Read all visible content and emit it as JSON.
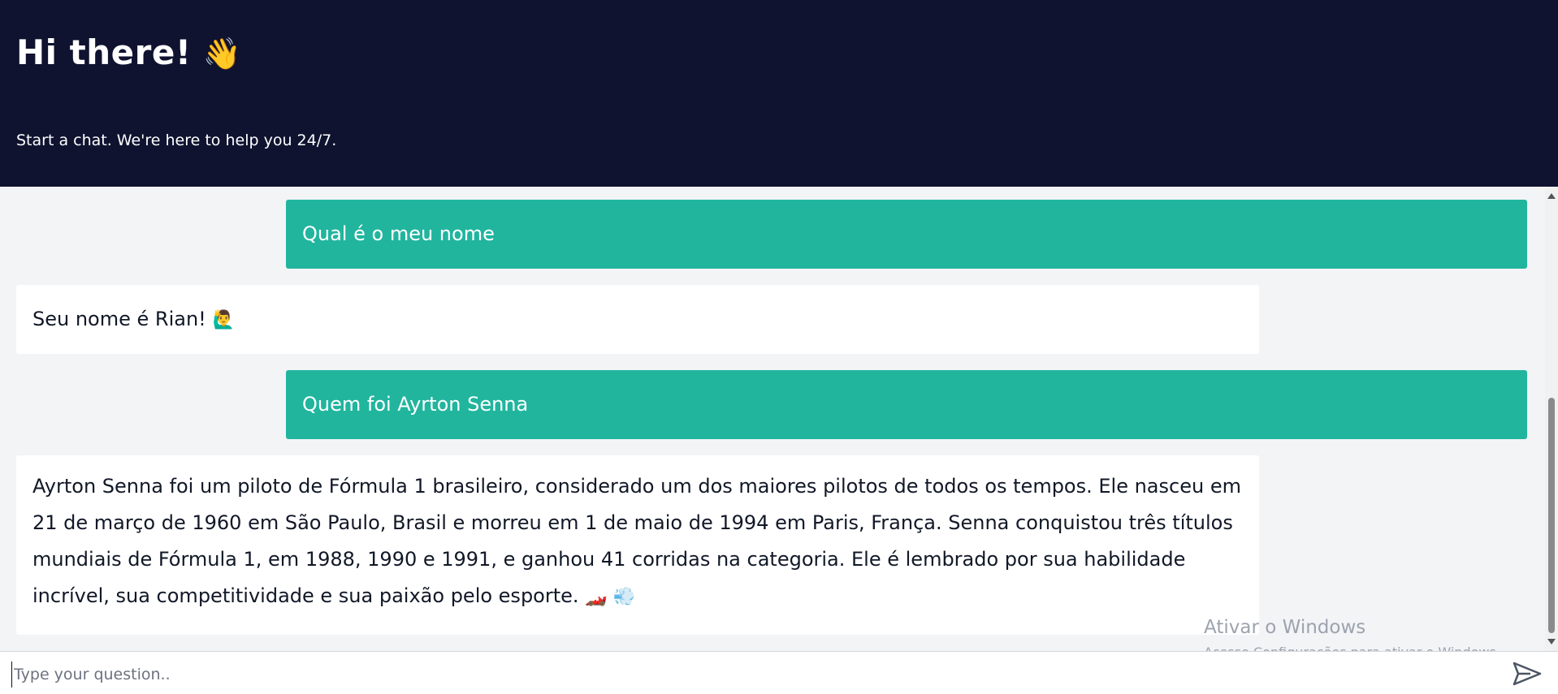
{
  "header": {
    "title": "Hi there!",
    "title_emoji": "👋",
    "subtitle": "Start a chat. We're here to help you 24/7."
  },
  "messages": [
    {
      "role": "user",
      "text": "Qual é o meu nome"
    },
    {
      "role": "bot",
      "text": "Seu nome é Rian!",
      "emoji": "🙋‍♂️"
    },
    {
      "role": "user",
      "text": "Quem foi Ayrton Senna"
    },
    {
      "role": "bot",
      "text": "Ayrton Senna foi um piloto de Fórmula 1 brasileiro, considerado um dos maiores pilotos de todos os tempos. Ele nasceu em 21 de março de 1960 em São Paulo, Brasil e morreu em 1 de maio de 1994 em Paris, França. Senna conquistou três títulos mundiais de Fórmula 1, em 1988, 1990 e 1991, e ganhou 41 corridas na categoria. Ele é lembrado por sua habilidade incrível, sua competitividade e sua paixão pelo esporte.",
      "emoji": "🏎️ 💨"
    }
  ],
  "input": {
    "placeholder": "Type your question..",
    "value": ""
  },
  "send_icon": "send-icon",
  "watermark": {
    "title": "Ativar o Windows",
    "subtitle": "Acesse Configurações para ativar o Windows."
  },
  "colors": {
    "header_bg": "#0f1330",
    "user_bubble": "#21b59e",
    "bot_bubble": "#ffffff",
    "chat_bg": "#f3f4f6"
  }
}
